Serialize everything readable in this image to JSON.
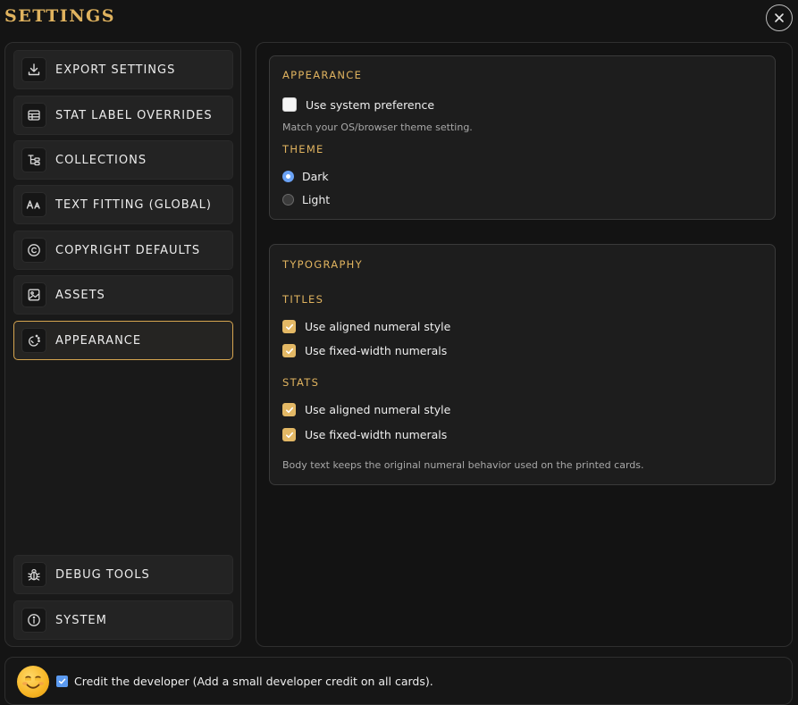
{
  "header": {
    "title": "SETTINGS",
    "close_icon": "close-icon"
  },
  "sidebar": {
    "items": [
      {
        "label": "EXPORT SETTINGS",
        "icon": "download-icon"
      },
      {
        "label": "STAT LABEL OVERRIDES",
        "icon": "table-icon"
      },
      {
        "label": "COLLECTIONS",
        "icon": "tree-icon"
      },
      {
        "label": "TEXT FITTING (GLOBAL)",
        "icon": "text-size-icon"
      },
      {
        "label": "COPYRIGHT DEFAULTS",
        "icon": "copyright-icon"
      },
      {
        "label": "ASSETS",
        "icon": "image-icon"
      },
      {
        "label": "APPEARANCE",
        "icon": "palette-icon",
        "active": true
      }
    ],
    "bottom_items": [
      {
        "label": "DEBUG TOOLS",
        "icon": "bug-icon"
      },
      {
        "label": "SYSTEM",
        "icon": "info-icon"
      }
    ]
  },
  "appearance": {
    "heading": "APPEARANCE",
    "system_pref_label": "Use system preference",
    "system_pref_checked": false,
    "system_pref_hint": "Match your OS/browser theme setting.",
    "theme_heading": "THEME",
    "theme_options": [
      {
        "label": "Dark",
        "selected": true
      },
      {
        "label": "Light",
        "selected": false
      }
    ]
  },
  "typography": {
    "heading": "TYPOGRAPHY",
    "titles_heading": "TITLES",
    "titles_options": [
      {
        "label": "Use aligned numeral style",
        "checked": true
      },
      {
        "label": "Use fixed-width numerals",
        "checked": true
      }
    ],
    "stats_heading": "STATS",
    "stats_options": [
      {
        "label": "Use aligned numeral style",
        "checked": true
      },
      {
        "label": "Use fixed-width numerals",
        "checked": true
      }
    ],
    "note": "Body text keeps the original numeral behavior used on the printed cards."
  },
  "footer": {
    "credit_label": "Credit the developer (Add a small developer credit on all cards).",
    "credit_checked": true,
    "emoji_icon": "smiley-emoji-icon"
  },
  "colors": {
    "accent_gold": "#e0b35f",
    "checkbox_gold": "#e3b865",
    "radio_blue": "#6aa2f5",
    "background": "#141414"
  }
}
